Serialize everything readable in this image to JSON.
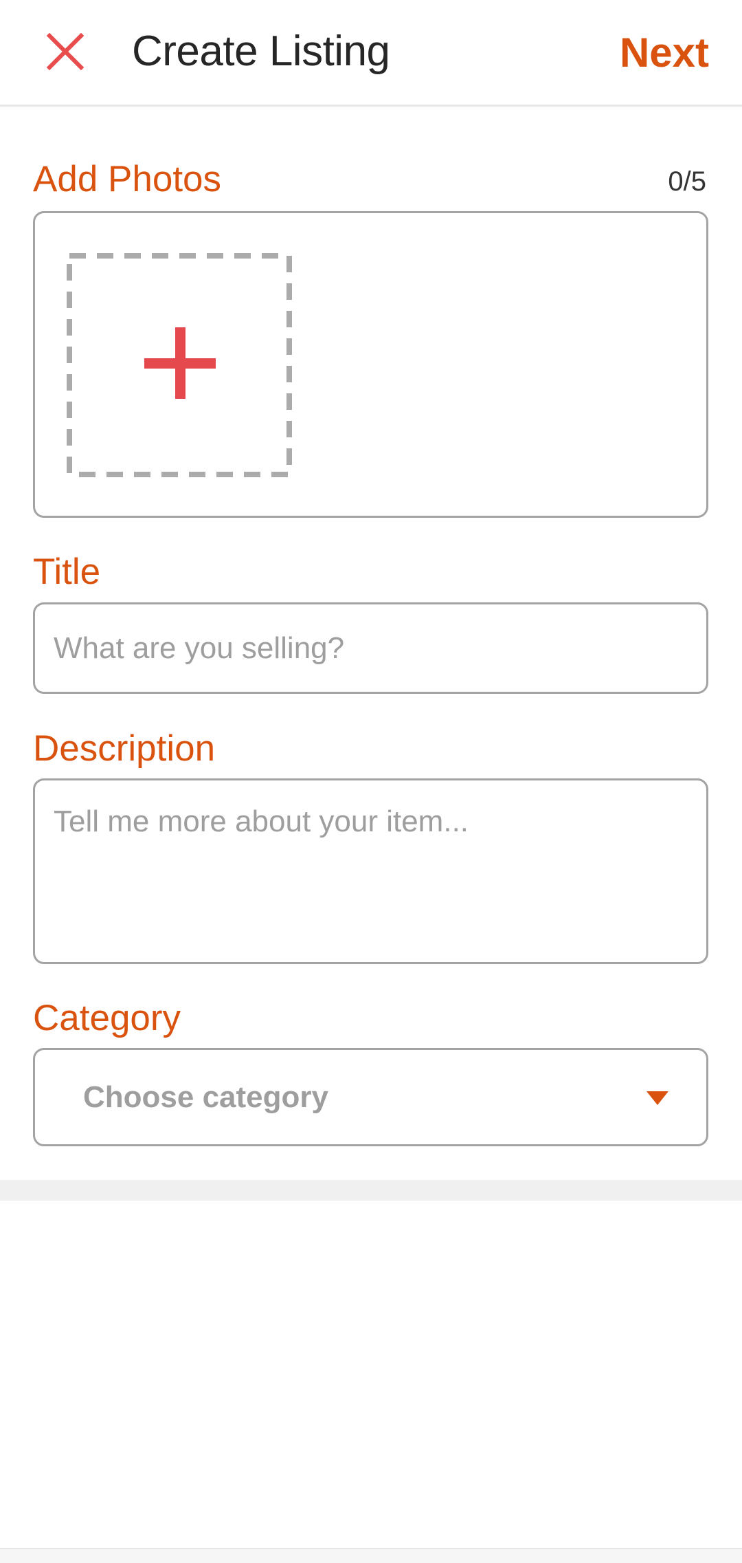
{
  "header": {
    "title": "Create Listing",
    "next_label": "Next",
    "close_icon": "close-icon"
  },
  "photos": {
    "label": "Add Photos",
    "counter": "0/5",
    "add_icon": "plus-icon"
  },
  "title_field": {
    "label": "Title",
    "placeholder": "What are you selling?",
    "value": ""
  },
  "description_field": {
    "label": "Description",
    "placeholder": "Tell me more about your item...",
    "value": ""
  },
  "category_field": {
    "label": "Category",
    "selected": "Choose category",
    "icon": "caret-down-icon"
  },
  "colors": {
    "accent": "#d9530f",
    "close_icon": "#e84c4c",
    "plus_icon": "#e5484d",
    "border": "#a3a3a3",
    "placeholder": "#9e9e9e"
  }
}
